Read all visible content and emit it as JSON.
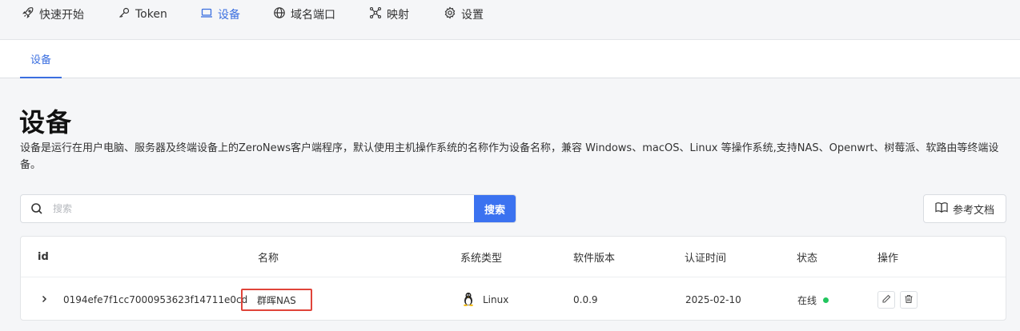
{
  "nav": {
    "items": [
      {
        "label": "快速开始",
        "icon": "rocket-icon"
      },
      {
        "label": "Token",
        "icon": "key-icon"
      },
      {
        "label": "设备",
        "icon": "laptop-icon",
        "active": true
      },
      {
        "label": "域名端口",
        "icon": "globe-icon"
      },
      {
        "label": "映射",
        "icon": "network-icon"
      },
      {
        "label": "设置",
        "icon": "gear-icon"
      }
    ],
    "active_color": "#3b6fe0"
  },
  "subtabs": {
    "active": "设备"
  },
  "page": {
    "title": "设备",
    "description": "设备是运行在用户电脑、服务器及终端设备上的ZeroNews客户端程序，默认使用主机操作系统的名称作为设备名称，兼容 Windows、macOS、Linux 等操作系统,支持NAS、Openwrt、树莓派、软路由等终端设备。"
  },
  "search": {
    "placeholder": "搜索",
    "button": "搜索",
    "value": ""
  },
  "docs_button": "参考文档",
  "table": {
    "columns": [
      "id",
      "名称",
      "系统类型",
      "软件版本",
      "认证时间",
      "状态",
      "操作"
    ],
    "rows": [
      {
        "id": "0194efe7f1cc7000953623f14711e0cd",
        "name": "群晖NAS",
        "os": "Linux",
        "version": "0.0.9",
        "auth_time": "2025-02-10",
        "status": "在线"
      }
    ]
  },
  "colors": {
    "primary": "#3b72f0",
    "online": "#22c55e",
    "highlight": "#e0443a"
  }
}
